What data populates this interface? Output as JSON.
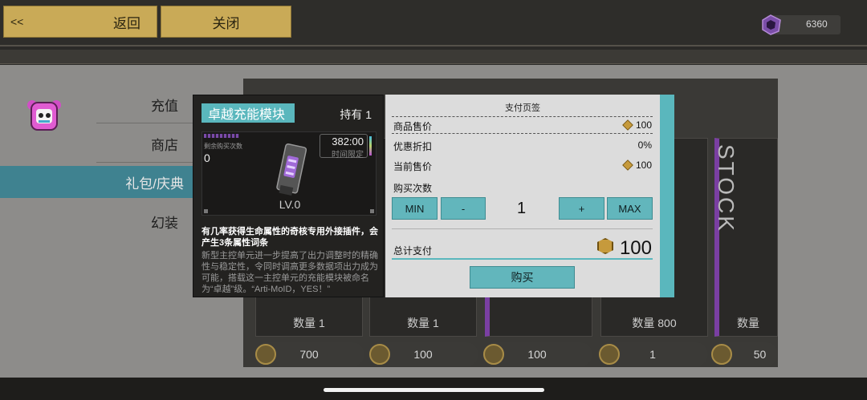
{
  "header": {
    "back_arrow": "<<",
    "back_label": "返回",
    "close_label": "关闭",
    "currency_value": "6360",
    "currency_icon": "purple-gem-icon"
  },
  "sidebar": {
    "items": [
      {
        "label": "充值",
        "active": false
      },
      {
        "label": "商店",
        "active": false
      },
      {
        "label": "礼包/庆典",
        "active": true
      },
      {
        "label": "幻装",
        "active": false
      }
    ]
  },
  "shop": {
    "cards": [
      {
        "qty": "数量 1",
        "price": "700"
      },
      {
        "qty": "数量 1",
        "price": "100"
      },
      {
        "qty": "",
        "price": "100"
      },
      {
        "qty": "数量 800",
        "price": "1"
      },
      {
        "qty": "数量",
        "price": "50"
      }
    ],
    "stock_label": "STOCK"
  },
  "item": {
    "name": "卓越充能模块",
    "owned": "持有 1",
    "remaining_label": "剩余购买次数",
    "remaining_value": "0",
    "timer_value": "382:00",
    "timer_label": "时间限定",
    "level": "LV.0",
    "desc_bold": "有几率获得生命属性的奇核专用外接插件，会产生3条属性词条",
    "desc": "新型主控单元进一步提高了出力调整时的精确性与稳定性，令同时调高更多数据项出力成为可能，搭载这一主控单元的充能模块被命名为“卓越”级。“Arti-MoID，YES！”"
  },
  "payment": {
    "title": "支付页签",
    "price_label": "商品售价",
    "price_value": "100",
    "discount_label": "优惠折扣",
    "discount_value": "0%",
    "current_label": "当前售价",
    "current_value": "100",
    "count_label": "购买次数",
    "min_label": "MIN",
    "minus_label": "-",
    "quantity": "1",
    "plus_label": "+",
    "max_label": "MAX",
    "total_label": "总计支付",
    "total_value": "100",
    "buy_label": "购买"
  },
  "colors": {
    "accent": "#5ab7bd",
    "gold_button": "#c9aa57",
    "active_tab": "#3f8290"
  }
}
